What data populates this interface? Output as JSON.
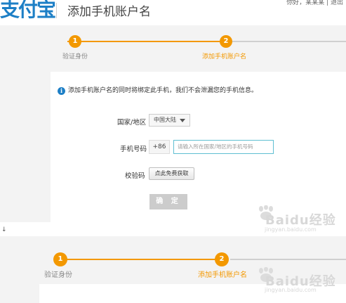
{
  "header": {
    "logo_text": "支付宝",
    "title": "添加手机账户名",
    "user_links": "你好，某某某  |  退出"
  },
  "steps": {
    "step1_num": "1",
    "step1_label": "验证身份",
    "step2_num": "2",
    "step2_label": "添加手机账户名"
  },
  "form": {
    "notice": "添加手机账户名的同时将绑定此手机，我们不会泄漏您的手机信息。",
    "country_label": "国家/地区",
    "country_value": "中国大陆",
    "phone_label": "手机号码",
    "phone_prefix": "+86",
    "phone_placeholder": "请输入所在国家/地区的手机号码",
    "code_label": "校验码",
    "code_button": "点此免费获取",
    "confirm_button": "确 定"
  },
  "separator_mark": "↓",
  "watermark": {
    "main": "Baidu经验",
    "sub": "jingyan.baidu.com"
  },
  "colors": {
    "accent_orange": "#f39800",
    "brand_blue": "#1d7fc6",
    "input_focus": "#5fbfd2",
    "page_gray": "#f3f3f3"
  }
}
